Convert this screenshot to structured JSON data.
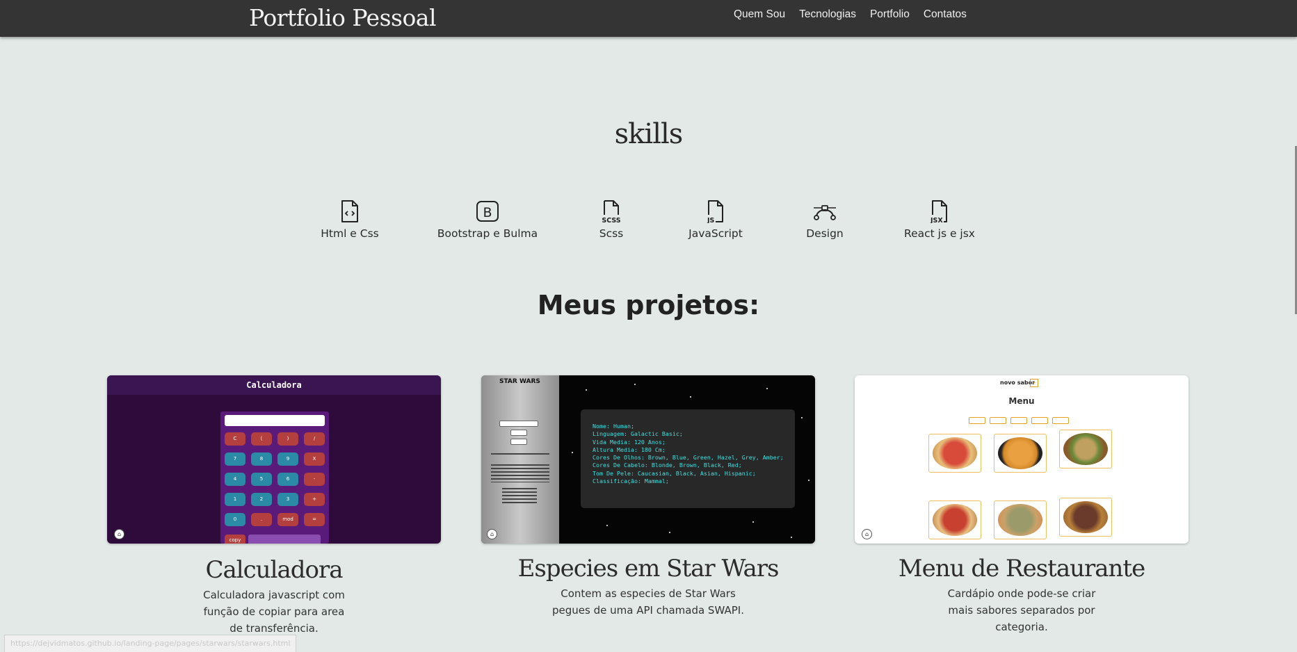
{
  "navbar": {
    "brand": "Portfolio Pessoal",
    "links": [
      "Quem Sou",
      "Tecnologias",
      "Portfolio",
      "Contatos"
    ]
  },
  "skills": {
    "title": "skills",
    "items": [
      {
        "label": "Html e Css",
        "icon": "file-code-icon"
      },
      {
        "label": "Bootstrap e Bulma",
        "icon": "bootstrap-icon"
      },
      {
        "label": "Scss",
        "icon": "file-scss-icon"
      },
      {
        "label": "JavaScript",
        "icon": "file-js-icon"
      },
      {
        "label": "Design",
        "icon": "bezier-curve-icon"
      },
      {
        "label": "React js e jsx",
        "icon": "file-jsx-icon"
      }
    ]
  },
  "projects": {
    "title": "Meus projetos:",
    "items": [
      {
        "title": "Calculadora",
        "description": "Calculadora javascript com função de copiar para area de transferência.",
        "thumb": {
          "header": "Calculadora",
          "keys": [
            "C",
            "(",
            ")",
            "/",
            "7",
            "8",
            "9",
            "X",
            "4",
            "5",
            "6",
            "-",
            "1",
            "2",
            "3",
            "+",
            "0",
            ".",
            "mod",
            "="
          ],
          "copy": "copy"
        }
      },
      {
        "title": "Especies em Star Wars",
        "description": "Contem as especies de Star Wars pegues de uma API chamada SWAPI.",
        "thumb": {
          "logo": "STAR WARS",
          "text": "Nome: Human;\nLinguagem: Galactic Basic;\nVida Media: 120 Anos;\nAltura Media: 180 Cm;\nCores De Olhos: Brown, Blue, Green, Hazel, Grey, Amber;\nCores De Cabelo: Blonde, Brown, Black, Red;\nTom De Pele: Caucasian, Black, Asian, Hispanic;\nClassificação: Mammal;"
        }
      },
      {
        "title": "Menu de Restaurante",
        "description": "Cardápio onde pode-se criar mais sabores separados por categoria.",
        "thumb": {
          "brand": "novo sabor",
          "plus": "+",
          "title": "Menu"
        }
      }
    ]
  },
  "status_url": "https://dejvidmatos.github.io/landing-page/pages/starwars/starwars.html",
  "colors": {
    "navbar": "#343434",
    "background": "#e3e9e7",
    "calc_red": "#b3403f",
    "calc_blue": "#2b8ba6",
    "sw_text": "#3fe0e0"
  }
}
